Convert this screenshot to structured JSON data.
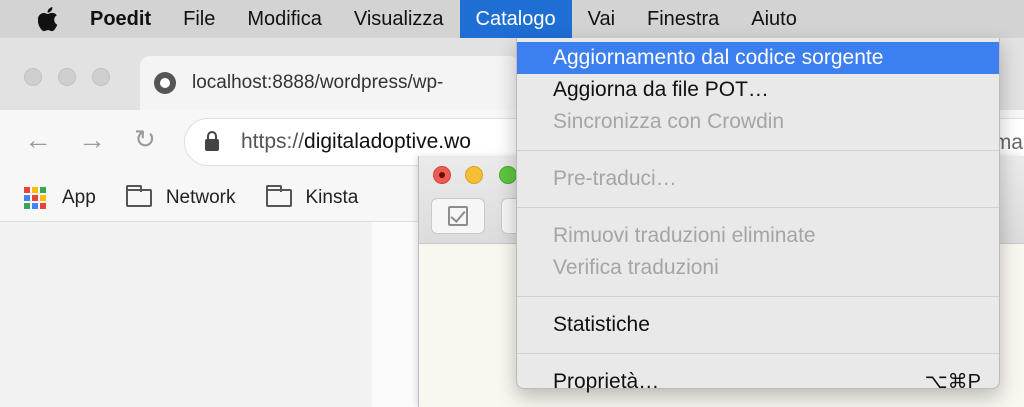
{
  "menubar": {
    "apple_icon": "apple-icon",
    "items": [
      {
        "label": "Poedit"
      },
      {
        "label": "File"
      },
      {
        "label": "Modifica"
      },
      {
        "label": "Visualizza"
      },
      {
        "label": "Catalogo"
      },
      {
        "label": "Vai"
      },
      {
        "label": "Finestra"
      },
      {
        "label": "Aiuto"
      }
    ]
  },
  "browser": {
    "tab_title": "localhost:8888/wordpress/wp-",
    "url_prefix": "https://",
    "url_host": "digitaladoptive.wo",
    "url_tail": "ma",
    "bookmarks": [
      {
        "label": "App",
        "icon": "apps-grid-icon"
      },
      {
        "label": "Network",
        "icon": "folder-icon"
      },
      {
        "label": "Kinsta",
        "icon": "folder-icon"
      }
    ],
    "apps_colors": [
      "#ea4335",
      "#fbbc05",
      "#34a853",
      "#4285f4",
      "#ea4335",
      "#fbbc05",
      "#34a853",
      "#4285f4",
      "#ea4335"
    ]
  },
  "catalog_menu": {
    "items": [
      {
        "label": "Aggiornamento dal codice sorgente",
        "state": "highlighted"
      },
      {
        "label": "Aggiorna da file POT…",
        "state": "enabled"
      },
      {
        "label": "Sincronizza con Crowdin",
        "state": "disabled"
      },
      {
        "label": "Pre-traduci…",
        "state": "disabled"
      },
      {
        "label": "Rimuovi traduzioni eliminate",
        "state": "disabled"
      },
      {
        "label": "Verifica traduzioni",
        "state": "disabled"
      },
      {
        "label": "Statistiche",
        "state": "enabled"
      },
      {
        "label": "Proprietà…",
        "state": "enabled",
        "shortcut": "⌥⌘P"
      }
    ]
  },
  "colors": {
    "menu_highlight": "#3b7ff0",
    "menubar_active": "#1f6ed4"
  }
}
